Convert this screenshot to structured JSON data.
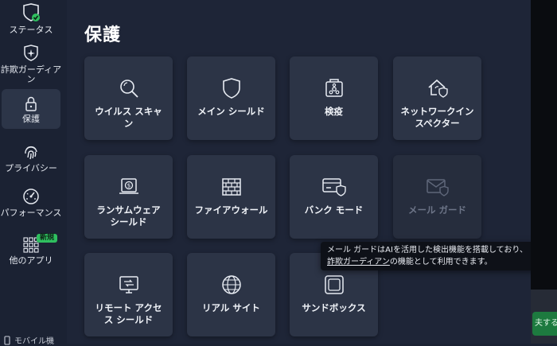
{
  "sidebar": {
    "items": [
      {
        "label": "ステータス"
      },
      {
        "label": "詐欺ガーディア\nン"
      },
      {
        "label": "保護"
      },
      {
        "label": "プライバシー"
      },
      {
        "label": "パフォーマンス"
      },
      {
        "label": "他のアプリ"
      }
    ],
    "new_badge": "新規",
    "mobile_label": "モバイル機"
  },
  "main": {
    "title": "保護",
    "tiles": [
      {
        "label": "ウイルス スキャ\nン",
        "icon": "magnifier-icon"
      },
      {
        "label": "メイン シールド",
        "icon": "shield-icon"
      },
      {
        "label": "検疫",
        "icon": "quarantine-icon"
      },
      {
        "label": "ネットワークイン\nスペクター",
        "icon": "network-house-icon"
      },
      {
        "label": "ランサムウェア\nシールド",
        "icon": "ransomware-icon"
      },
      {
        "label": "ファイアウォール",
        "icon": "brick-wall-icon"
      },
      {
        "label": "バンク モード",
        "icon": "bank-card-shield-icon"
      },
      {
        "label": "メール ガード",
        "icon": "mail-shield-icon"
      },
      {
        "label": "リモート アクセ\nス シールド",
        "icon": "remote-monitor-icon"
      },
      {
        "label": "リアル サイト",
        "icon": "globe-icon"
      },
      {
        "label": "サンドボックス",
        "icon": "sandbox-icon"
      }
    ]
  },
  "tooltip": {
    "line1": "メール ガードはAIを活用した検出機能を搭載しており、",
    "link": "詐欺ガーディアン",
    "line2_rest": "の機能として利用できます。"
  },
  "right_panel": {
    "button_label": "夫する"
  },
  "colors": {
    "accent_green": "#2fbf5f",
    "background": "#1e2537",
    "tile": "#2c3446"
  }
}
